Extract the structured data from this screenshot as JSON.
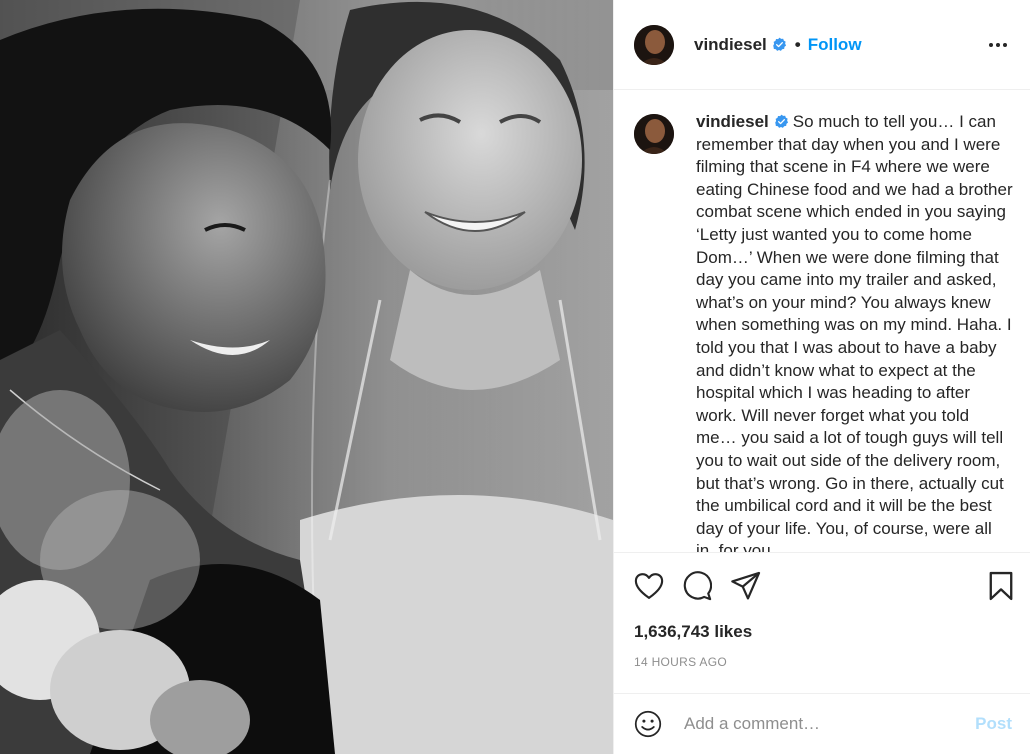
{
  "post": {
    "username": "vindiesel",
    "dot": "•",
    "follow_label": "Follow",
    "more_icon": "more-options-icon",
    "caption_text": "So much to tell you… I can remember that day when you and I were filming that scene in F4 where we were eating Chinese food and we had a brother combat scene which ended in you saying ‘Letty just wanted you to come home Dom…’ When we were done filming that day you came into my trailer and asked, what’s on your mind? You always knew when something was on my mind. Haha. I told you that I was about to have a baby and didn’t know what to expect at the hospital which I was heading to after work. Will never forget what you told me… you said a lot of tough guys will tell you to wait out side of the delivery room, but that’s wrong. Go in there, actually cut the umbilical cord and it will be the best day of your life. You, of course, were all in, for you",
    "likes": "1,636,743 likes",
    "timestamp": "14 HOURS AGO",
    "comment_placeholder": "Add a comment…",
    "post_label": "Post"
  },
  "icons": {
    "like": "heart-icon",
    "comment": "comment-bubble-icon",
    "share": "paper-plane-icon",
    "save": "bookmark-icon",
    "emoji": "smiley-icon",
    "verified": "verified-badge-icon"
  },
  "colors": {
    "accent": "#0095f6",
    "verified": "#3897f0",
    "post_disabled": "#b2dffc",
    "muted": "#8e8e8e",
    "text": "#262626"
  }
}
